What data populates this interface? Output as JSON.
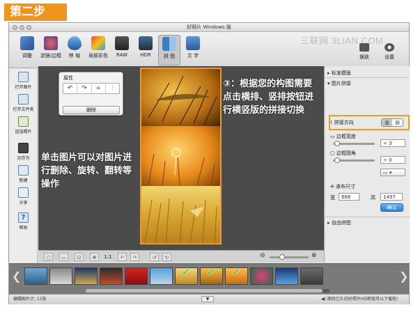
{
  "step_badge": "第二步",
  "window": {
    "title": "好照片 Windows 版"
  },
  "watermark": "三联网 3LIAN.COM",
  "toolbar": {
    "items": [
      {
        "label": "调整"
      },
      {
        "label": "滤镜/边框"
      },
      {
        "label": "移 轴"
      },
      {
        "label": "局部彩色"
      },
      {
        "label": "RAW"
      },
      {
        "label": "HDR"
      },
      {
        "label": "拼 图"
      },
      {
        "label": "文 字"
      }
    ],
    "skin_label": "换肤",
    "settings_label": "设置"
  },
  "leftbar": {
    "items": [
      {
        "label": "打开图片"
      },
      {
        "label": "打开文件夹"
      },
      {
        "label": "追加照片"
      },
      {
        "label": "另存为"
      },
      {
        "label": "新建"
      },
      {
        "label": "分享"
      },
      {
        "label": "帮助"
      }
    ]
  },
  "properties_panel": {
    "title": "属性",
    "icons": [
      "rotate-ccw-icon",
      "rotate-cw-icon",
      "flip-vertical-icon",
      "flip-horizontal-icon"
    ],
    "delete_label": "删除"
  },
  "annotations": {
    "left_text": "单击图片可以对图片进行删除、旋转、翻转等操作",
    "right_text": "③：根据您的构图需要点击横排、竖排按钮进行横竖版的拼接切换"
  },
  "canvas_bottom": {
    "zoom_label": "1:1"
  },
  "right_panel": {
    "standard_template": "标准模版",
    "image_stitch": "图片拼接",
    "stitch_direction": "拼接方向",
    "border_width": "边框宽度",
    "border_width_value": "3",
    "border_radius": "边框圆角",
    "border_radius_value": "0",
    "canvas_size": "桌布尺寸",
    "width_label": "宽",
    "width_value": "666",
    "height_label": "高",
    "height_value": "1497",
    "apply_label": "确认",
    "free_stitch": "自由拼图"
  },
  "status": {
    "left": "编辑图片计: 13张",
    "right": "期待已久的好照片HD新版可以下载啦!"
  },
  "colors": {
    "accent": "#f29a1e",
    "badge": "#f0941e"
  }
}
